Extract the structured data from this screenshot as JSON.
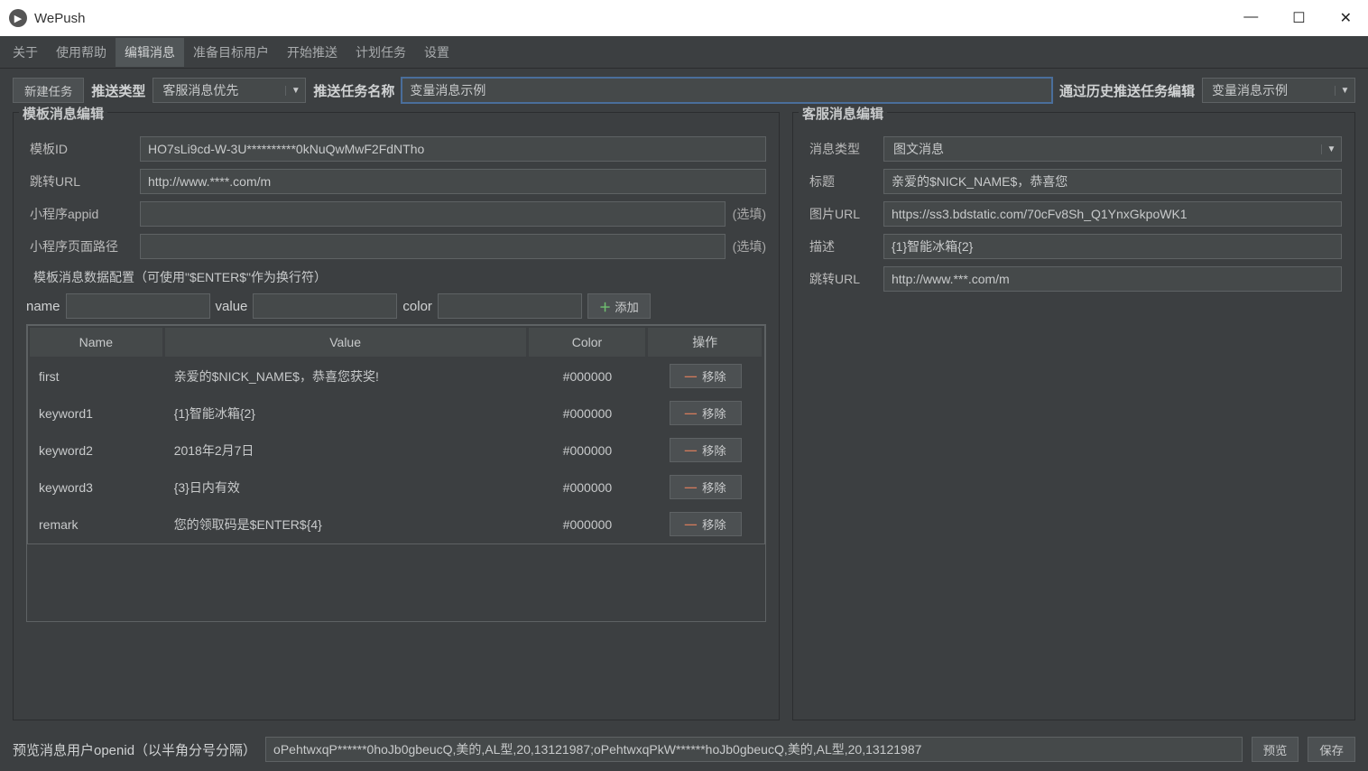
{
  "app_title": "WePush",
  "menu": {
    "items": [
      "关于",
      "使用帮助",
      "编辑消息",
      "准备目标用户",
      "开始推送",
      "计划任务",
      "设置"
    ],
    "active_index": 2
  },
  "toolbar": {
    "new_task_btn": "新建任务",
    "push_type_label": "推送类型",
    "push_type_value": "客服消息优先",
    "task_name_label": "推送任务名称",
    "task_name_value": "变量消息示例",
    "history_edit_label": "通过历史推送任务编辑",
    "history_value": "变量消息示例"
  },
  "template_panel": {
    "title": "模板消息编辑",
    "template_id_label": "模板ID",
    "template_id_value": "HO7sLi9cd-W-3U**********0kNuQwMwF2FdNTho",
    "redirect_url_label": "跳转URL",
    "redirect_url_value": "http://www.****.com/m",
    "miniapp_id_label": "小程序appid",
    "miniapp_id_value": "",
    "miniapp_id_hint": "(选填)",
    "miniapp_path_label": "小程序页面路径",
    "miniapp_path_value": "",
    "miniapp_path_hint": "(选填)",
    "data_config_title": "模板消息数据配置（可使用\"$ENTER$\"作为换行符）",
    "add_row_labels": {
      "name": "name",
      "value": "value",
      "color": "color"
    },
    "add_btn": "添加",
    "columns": {
      "name": "Name",
      "value": "Value",
      "color": "Color",
      "ops": "操作"
    },
    "remove_btn": "移除",
    "rows": [
      {
        "name": "first",
        "value": "亲爱的$NICK_NAME$，恭喜您获奖!",
        "color": "#000000"
      },
      {
        "name": "keyword1",
        "value": "{1}智能冰箱{2}",
        "color": "#000000"
      },
      {
        "name": "keyword2",
        "value": "2018年2月7日",
        "color": "#000000"
      },
      {
        "name": "keyword3",
        "value": "{3}日内有效",
        "color": "#000000"
      },
      {
        "name": "remark",
        "value": "您的领取码是$ENTER${4}",
        "color": "#000000"
      }
    ]
  },
  "customer_panel": {
    "title": "客服消息编辑",
    "msg_type_label": "消息类型",
    "msg_type_value": "图文消息",
    "title_label": "标题",
    "title_value": "亲爱的$NICK_NAME$，恭喜您",
    "img_url_label": "图片URL",
    "img_url_value": "https://ss3.bdstatic.com/70cFv8Sh_Q1YnxGkpoWK1",
    "desc_label": "描述",
    "desc_value": "{1}智能冰箱{2}",
    "redirect_url_label": "跳转URL",
    "redirect_url_value": "http://www.***.com/m"
  },
  "footer": {
    "preview_openid_label": "预览消息用户openid（以半角分号分隔）",
    "preview_openid_value": "oPehtwxqP******0hoJb0gbeucQ,美的,AL型,20,13121987;oPehtwxqPkW******hoJb0gbeucQ,美的,AL型,20,13121987",
    "preview_btn": "预览",
    "save_btn": "保存"
  }
}
